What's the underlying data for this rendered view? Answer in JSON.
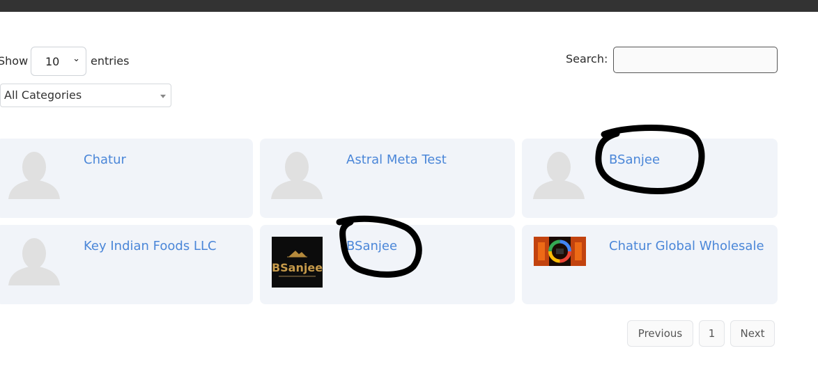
{
  "controls": {
    "show_label": "Show",
    "page_length": "10",
    "entries_label": "entries",
    "search_label": "Search:",
    "search_value": "",
    "category_filter": "All Categories"
  },
  "cards": [
    {
      "name": "Chatur",
      "image": "avatar-placeholder"
    },
    {
      "name": "Astral Meta Test",
      "image": "avatar-placeholder"
    },
    {
      "name": "BSanjee",
      "image": "avatar-placeholder",
      "circled": true
    },
    {
      "name": "Key Indian Foods LLC",
      "image": "avatar-placeholder"
    },
    {
      "name": "BSanjee",
      "image": "bsanjee-logo",
      "logo_text": "BSanjee",
      "circled": true
    },
    {
      "name": "Chatur Global Wholesale",
      "image": "chatur-global-logo"
    }
  ],
  "pagination": {
    "previous": "Previous",
    "current_page": "1",
    "next": "Next"
  },
  "colors": {
    "card_bg": "#f1f4f9",
    "link": "#4a86d8",
    "topbar": "#333333"
  }
}
